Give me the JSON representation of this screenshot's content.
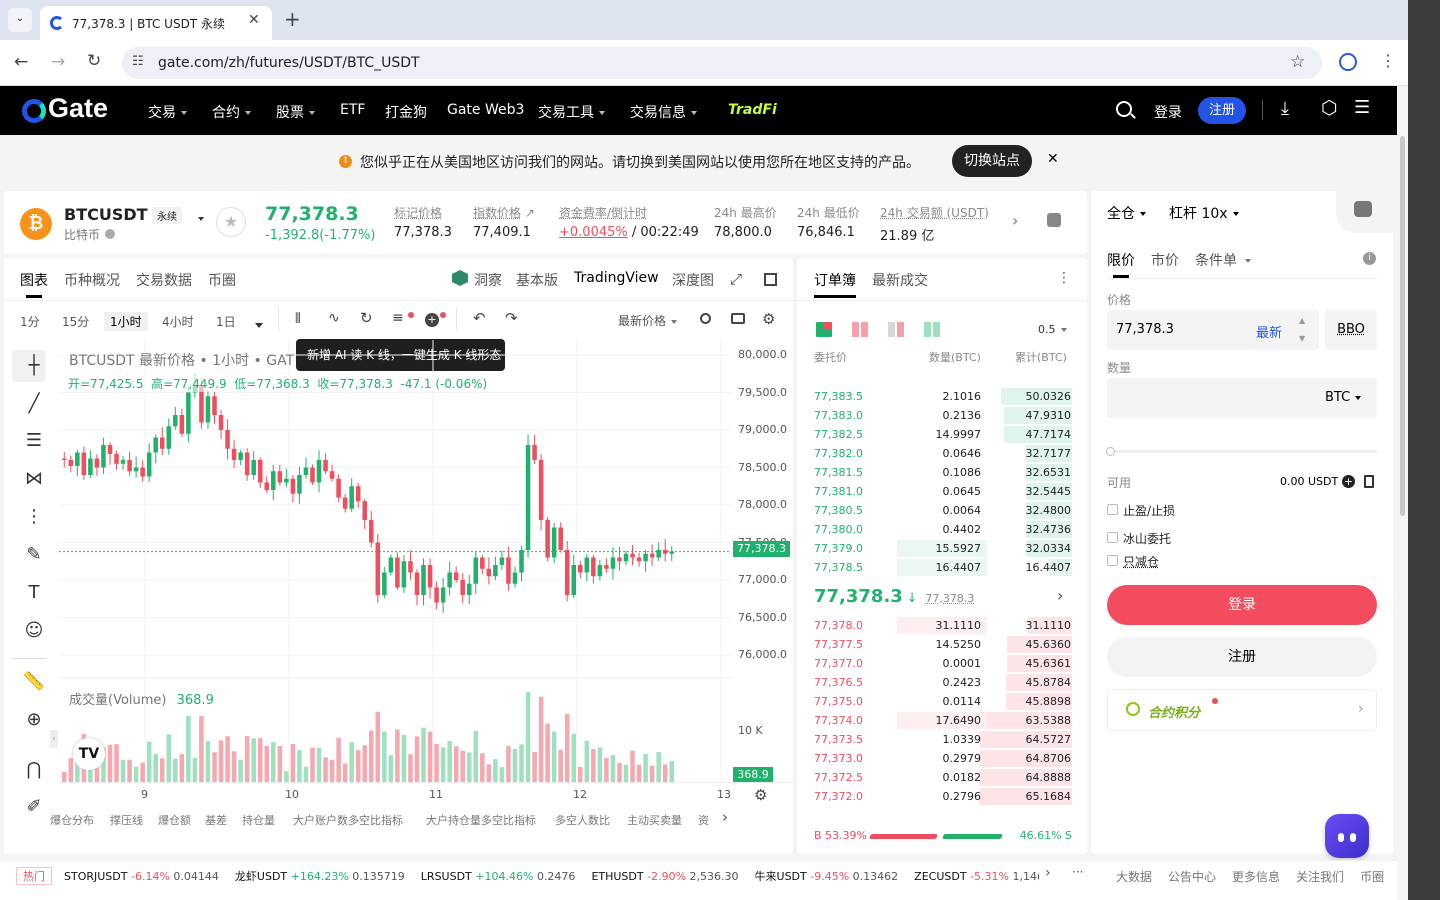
{
  "browser": {
    "tab_title": "77,378.3 | BTC USDT 永续",
    "url": "gate.com/zh/futures/USDT/BTC_USDT"
  },
  "nav": {
    "logo": "Gate",
    "items": [
      "交易",
      "合约",
      "股票",
      "ETF",
      "打金狗",
      "Gate Web3",
      "交易工具",
      "交易信息"
    ],
    "tradfi": "TradFi",
    "login": "登录",
    "register": "注册"
  },
  "banner": {
    "text": "您似乎正在从美国地区访问我们的网站。请切换到美国网站以使用您所在地区支持的产品。",
    "button": "切换站点"
  },
  "ticker": {
    "symbol": "BTCUSDT",
    "type_tag": "永续",
    "subtitle": "比特币",
    "price": "77,378.3",
    "change": "-1,392.8(-1.77%)",
    "stats": [
      {
        "label": "标记价格",
        "value": "77,378.3"
      },
      {
        "label": "指数价格",
        "value": "77,409.1"
      },
      {
        "label": "资金费率/倒计时",
        "value": "+0.0045%",
        "value2": "/ 00:22:49"
      },
      {
        "label": "24h 最高价",
        "value": "78,800.0"
      },
      {
        "label": "24h 最低价",
        "value": "76,846.1"
      },
      {
        "label": "24h 交易额 (USDT)",
        "value": "21.89 亿"
      }
    ]
  },
  "chart_tabs": {
    "left": [
      "图表",
      "币种概况",
      "交易数据",
      "币圈"
    ],
    "right": [
      "洞察",
      "基本版",
      "TradingView",
      "深度图"
    ]
  },
  "timeframes": [
    "1分",
    "15分",
    "1小时",
    "4小时",
    "1日"
  ],
  "price_type": "最新价格",
  "tooltip": "新增 AI 读 K 线，一键生成 K 线形态",
  "legend": {
    "title": "BTCUSDT 最新价格 • 1小时 • GAT",
    "ohlc": "开=77,425.5  高=77,449.9  低=77,368.3  收=77,378.3  -47.1 (-0.06%)",
    "volume_label": "成交量(Volume)",
    "volume_value": "368.9"
  },
  "chart_data": {
    "type": "candlestick",
    "price_ticks": [
      "80,000.0",
      "79,500.0",
      "79,000.0",
      "78,500.0",
      "78,000.0",
      "77,500.0",
      "77,000.0",
      "76,500.0",
      "76,000.0"
    ],
    "ylim": [
      75800,
      80200
    ],
    "last_price": "77,378.3",
    "volume_tick": "10 K",
    "volume_last": "368.9",
    "x_ticks": [
      "9",
      "10",
      "11",
      "12",
      "13"
    ],
    "close_series": [
      78600,
      78520,
      78700,
      78400,
      78620,
      78500,
      78800,
      78680,
      78550,
      78600,
      78450,
      78500,
      78380,
      78700,
      78900,
      78750,
      79050,
      79200,
      78950,
      79500,
      79600,
      79100,
      79450,
      79200,
      79000,
      78750,
      78600,
      78700,
      78400,
      78600,
      78300,
      78200,
      78450,
      78300,
      78350,
      78150,
      78400,
      78500,
      78300,
      78600,
      78450,
      78350,
      78100,
      77950,
      78250,
      78050,
      77800,
      77500,
      76800,
      77100,
      77300,
      76900,
      77250,
      77100,
      76800,
      77200,
      76900,
      76700,
      76900,
      77100,
      77000,
      76800,
      76950,
      77300,
      77150,
      77050,
      77200,
      77300,
      76950,
      77100,
      77400,
      78800,
      78600,
      77800,
      77300,
      77700,
      77400,
      76800,
      77200,
      77100,
      77300,
      77050,
      77200,
      77150,
      77300,
      77250,
      77350,
      77300,
      77250,
      77350,
      77300,
      77400,
      77350,
      77380
    ]
  },
  "bottom_tabs": [
    "爆仓分布",
    "撑压线",
    "爆仓额",
    "基差",
    "持仓量",
    "大户账户数多空比指标",
    "大户持仓量多空比指标",
    "多空人数比",
    "主动买卖量",
    "资"
  ],
  "orderbook": {
    "tabs": [
      "订单簿",
      "最新成交"
    ],
    "precision": "0.5",
    "headers": [
      "委托价",
      "数量(BTC)",
      "累计(BTC)"
    ],
    "asks": [
      [
        "77,383.5",
        "2.1016",
        "50.0326"
      ],
      [
        "77,383.0",
        "0.2136",
        "47.9310"
      ],
      [
        "77,382.5",
        "14.9997",
        "47.7174"
      ],
      [
        "77,382.0",
        "0.0646",
        "32.7177"
      ],
      [
        "77,381.5",
        "0.1086",
        "32.6531"
      ],
      [
        "77,381.0",
        "0.0645",
        "32.5445"
      ],
      [
        "77,380.5",
        "0.0064",
        "32.4800"
      ],
      [
        "77,380.0",
        "0.4402",
        "32.4736"
      ],
      [
        "77,379.0",
        "15.5927",
        "32.0334"
      ],
      [
        "77,378.5",
        "16.4407",
        "16.4407"
      ]
    ],
    "mid_price": "77,378.3",
    "mark_price": "77,378.3",
    "bids": [
      [
        "77,378.0",
        "31.1110",
        "31.1110"
      ],
      [
        "77,377.5",
        "14.5250",
        "45.6360"
      ],
      [
        "77,377.0",
        "0.0001",
        "45.6361"
      ],
      [
        "77,376.5",
        "0.2423",
        "45.8784"
      ],
      [
        "77,375.0",
        "0.0114",
        "45.8898"
      ],
      [
        "77,374.0",
        "17.6490",
        "63.5388"
      ],
      [
        "77,373.5",
        "1.0339",
        "64.5727"
      ],
      [
        "77,373.0",
        "0.2979",
        "64.8706"
      ],
      [
        "77,372.5",
        "0.0182",
        "64.8888"
      ],
      [
        "77,372.0",
        "0.2796",
        "65.1684"
      ]
    ],
    "buy_ratio": "B 53.39%",
    "sell_ratio": "46.61% S",
    "buy_fraction": 0.5339
  },
  "trade": {
    "margin_mode": "全仓",
    "leverage": "杠杆 10x",
    "order_types": [
      "限价",
      "市价",
      "条件单"
    ],
    "price_label": "价格",
    "price_value": "77,378.3",
    "latest": "最新",
    "bbo": "BBO",
    "qty_label": "数量",
    "qty_unit": "BTC",
    "available_label": "可用",
    "available_value": "0.00 USDT",
    "options": [
      "止盈/止损",
      "冰山委托",
      "只减仓"
    ],
    "login_btn": "登录",
    "register_btn": "注册",
    "points": "合约积分"
  },
  "marquee": {
    "hot": "热门",
    "items": [
      {
        "sym": "STORJUSDT",
        "chg": "-6.14%",
        "price": "0.04144",
        "up": false
      },
      {
        "sym": "龙虾USDT",
        "chg": "+164.23%",
        "price": "0.135719",
        "up": true
      },
      {
        "sym": "LRSUSDT",
        "chg": "+104.46%",
        "price": "0.2476",
        "up": true
      },
      {
        "sym": "ETHUSDT",
        "chg": "-2.90%",
        "price": "2,536.30",
        "up": false
      },
      {
        "sym": "牛来USDT",
        "chg": "-9.45%",
        "price": "0.13462",
        "up": false
      },
      {
        "sym": "ZECUSDT",
        "chg": "-5.31%",
        "price": "1,14(",
        "up": false
      }
    ],
    "links": [
      "大数据",
      "公告中心",
      "更多信息",
      "关注我们",
      "币圈"
    ]
  },
  "colors": {
    "up": "#20b26c",
    "down": "#ef4e5e",
    "brand": "#2354e6"
  }
}
